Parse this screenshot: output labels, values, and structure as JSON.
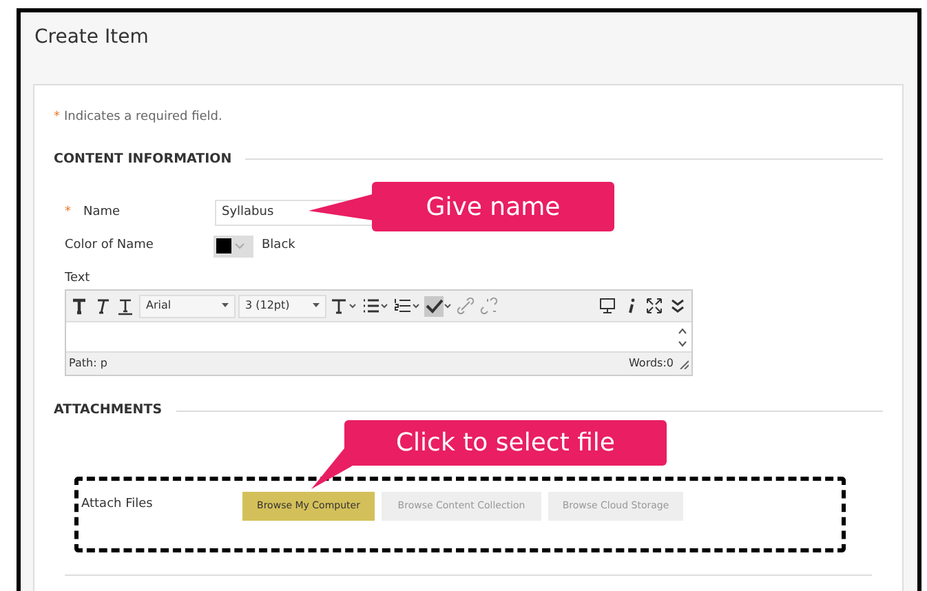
{
  "window": {
    "title": "Create Item"
  },
  "required_note": {
    "mark": "*",
    "text": "Indicates a required field."
  },
  "content_information": {
    "heading": "CONTENT INFORMATION",
    "name_field": {
      "mark": "*",
      "label": "Name",
      "value": "Syllabus"
    },
    "color_field": {
      "label": "Color of Name",
      "color": "#000000",
      "value": "Black"
    },
    "text_editor": {
      "label": "Text",
      "toolbar": [
        {
          "kind": "bold"
        },
        {
          "kind": "italic"
        },
        {
          "kind": "underline"
        },
        {
          "kind": "select",
          "text": "Arial"
        },
        {
          "kind": "select",
          "text": "3 (12pt)"
        },
        {
          "kind": "textcolor"
        },
        {
          "kind": "bullets"
        },
        {
          "kind": "numbers"
        },
        {
          "kind": "spellcheck"
        },
        {
          "kind": "link"
        },
        {
          "kind": "unlink"
        },
        {
          "kind": "preview"
        },
        {
          "kind": "info"
        },
        {
          "kind": "fullscreen"
        },
        {
          "kind": "more"
        }
      ],
      "path": "Path: p",
      "words": "Words:0"
    }
  },
  "attachments": {
    "heading": "ATTACHMENTS",
    "label": "Attach Files",
    "buttons": [
      {
        "label": "Browse My Computer",
        "disabled": false
      },
      {
        "label": "Browse Content Collection",
        "disabled": true
      },
      {
        "label": "Browse Cloud Storage",
        "disabled": true
      }
    ]
  },
  "callouts": [
    {
      "text": "Give name"
    },
    {
      "text": "Click to select file"
    }
  ]
}
